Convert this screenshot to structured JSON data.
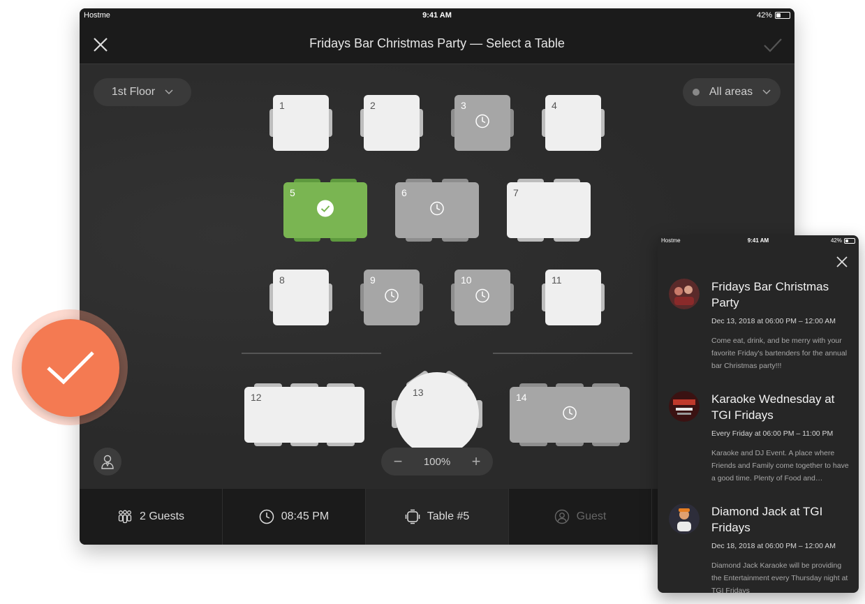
{
  "tablet": {
    "status": {
      "carrier": "Hostme",
      "time": "9:41 AM",
      "battery": "42%",
      "battery_level": 0.42
    },
    "nav": {
      "title": "Fridays Bar Christmas Party — Select a Table"
    },
    "floor_selector": {
      "label": "1st Floor"
    },
    "area_selector": {
      "label": "All areas"
    },
    "tables": [
      {
        "number": "1",
        "status": "free"
      },
      {
        "number": "2",
        "status": "free"
      },
      {
        "number": "3",
        "status": "reserved"
      },
      {
        "number": "4",
        "status": "free"
      },
      {
        "number": "5",
        "status": "selected"
      },
      {
        "number": "6",
        "status": "reserved"
      },
      {
        "number": "7",
        "status": "free"
      },
      {
        "number": "8",
        "status": "free"
      },
      {
        "number": "9",
        "status": "reserved"
      },
      {
        "number": "10",
        "status": "reserved"
      },
      {
        "number": "11",
        "status": "free"
      },
      {
        "number": "12",
        "status": "free"
      },
      {
        "number": "13",
        "status": "free"
      },
      {
        "number": "14",
        "status": "reserved"
      }
    ],
    "zoom": {
      "value": "100%",
      "minus": "−",
      "plus": "+"
    },
    "bottom_bar": {
      "guests": "2 Guests",
      "time": "08:45 PM",
      "table": "Table #5",
      "guest": "Guest"
    }
  },
  "phone": {
    "status": {
      "carrier": "Hostme",
      "time": "9:41 AM",
      "battery": "42%"
    },
    "events": [
      {
        "title": "Fridays Bar Christmas Party",
        "date": "Dec 13, 2018 at 06:00 PM – 12:00 AM",
        "description": "Come eat, drink, and be merry with your favorite Friday's bartenders for the annual bar Christmas party!!!"
      },
      {
        "title": "Karaoke Wednesday at TGI Fridays",
        "date": "Every Friday at 06:00 PM – 11:00 PM",
        "description": "Karaoke and DJ Event. A place where Friends and Family come together to have a good time. Plenty of Food and…"
      },
      {
        "title": "Diamond Jack at TGI Fridays",
        "date": "Dec 18, 2018 at 06:00 PM – 12:00 AM",
        "description": "Diamond Jack Karaoke will be providing the Entertainment every Thursday night at TGI Fridays"
      }
    ]
  },
  "colors": {
    "selected": "#7ab552",
    "accent": "#f47a52",
    "reserved": "#a6a6a6",
    "free": "#efefef"
  }
}
